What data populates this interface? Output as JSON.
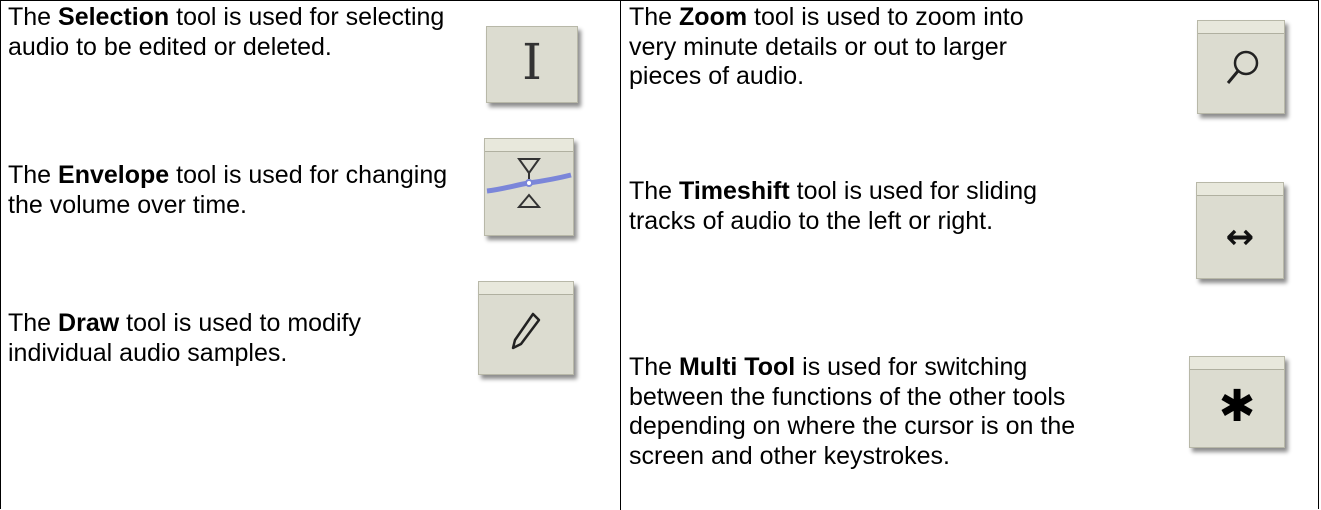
{
  "cells": {
    "selection": {
      "pre": "The ",
      "name": "Selection",
      "post": " tool is used for selecting audio to be edited or deleted."
    },
    "zoom": {
      "pre": "The ",
      "name": "Zoom",
      "post": " tool is used to zoom into very minute details or out to larger pieces of audio."
    },
    "envelope": {
      "pre": "The ",
      "name": "Envelope",
      "post": " tool is used for changing the volume over time."
    },
    "timeshift": {
      "pre": "The ",
      "name": "Timeshift",
      "post": " tool is used for sliding tracks of audio to the left or right."
    },
    "draw": {
      "pre": "The ",
      "name": "Draw",
      "post": " tool is used to modify individual audio samples."
    },
    "multi": {
      "pre": "The ",
      "name": "Multi Tool",
      "post": " is used for switching between the functions of the other tools depending on where the cursor is on the screen and other keystrokes."
    }
  },
  "icons": {
    "selection": "I-beam-icon",
    "zoom": "magnifier-icon",
    "envelope": "envelope-icon",
    "timeshift": "double-arrow-icon",
    "draw": "pencil-icon",
    "multi": "asterisk-icon"
  },
  "glyphs": {
    "selection": "I",
    "timeshift": "↔",
    "multi": "✱"
  },
  "colors": {
    "button_face": "#dcdcd0",
    "envelope_line": "#7b86d9"
  }
}
